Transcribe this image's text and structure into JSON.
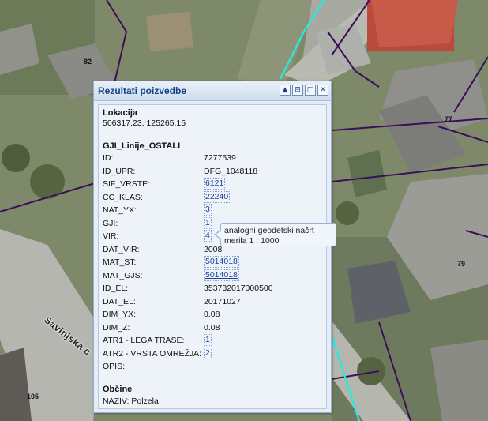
{
  "map": {
    "parcel_labels": [
      "82",
      "77",
      "79",
      "105"
    ],
    "street_label": "Savinjska c",
    "colors": {
      "parcel_boundary": "#3d0d5c",
      "highlight_line": "#2fe6e0",
      "roof_red": "#b94a3c",
      "grass": "#7f8a6a"
    }
  },
  "popup": {
    "title": "Rezultati poizvedbe",
    "header_icons": [
      "move-up-icon",
      "pin-icon",
      "maximize-icon",
      "close-icon"
    ],
    "location": {
      "title": "Lokacija",
      "coords": "506317.23, 125265.15"
    },
    "layer": {
      "title": "GJI_Linije_OSTALI",
      "rows": [
        {
          "label": "ID:",
          "value": "7277539",
          "style": "plain"
        },
        {
          "label": "ID_UPR:",
          "value": "DFG_1048118",
          "style": "plain"
        },
        {
          "label": "SIF_VRSTE:",
          "value": "6121",
          "style": "link"
        },
        {
          "label": "CC_KLAS:",
          "value": "22240",
          "style": "link"
        },
        {
          "label": "NAT_YX:",
          "value": "3",
          "style": "link"
        },
        {
          "label": "GJI:",
          "value": "1",
          "style": "link"
        },
        {
          "label": "VIR:",
          "value": "4",
          "style": "link"
        },
        {
          "label": "DAT_VIR:",
          "value": "2008",
          "style": "plain"
        },
        {
          "label": "MAT_ST:",
          "value": "5014018",
          "style": "ulink"
        },
        {
          "label": "MAT_GJS:",
          "value": "5014018",
          "style": "ulink"
        },
        {
          "label": "ID_EL:",
          "value": "353732017000500",
          "style": "plain"
        },
        {
          "label": "DAT_EL:",
          "value": "20171027",
          "style": "plain"
        },
        {
          "label": "DIM_YX:",
          "value": "0.08",
          "style": "plain"
        },
        {
          "label": "DIM_Z:",
          "value": "0.08",
          "style": "plain"
        },
        {
          "label": "ATR1 - LEGA TRASE:",
          "value": "1",
          "style": "link"
        },
        {
          "label": "ATR2 - VRSTA OMREŽJA:",
          "value": "2",
          "style": "link"
        },
        {
          "label": "OPIS:",
          "value": "",
          "style": "plain"
        }
      ]
    },
    "municipality": {
      "title": "Občine",
      "name": "NAZIV: Polzela"
    }
  },
  "tooltip": {
    "line1": "analogni geodetski načrt",
    "line2": "merila 1 : 1000"
  }
}
